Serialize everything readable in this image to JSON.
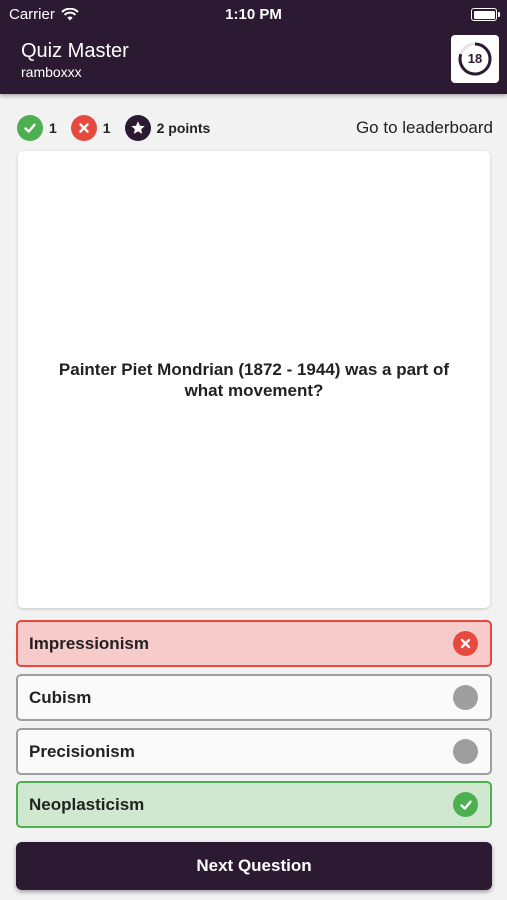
{
  "status_bar": {
    "carrier": "Carrier",
    "time": "1:10 PM"
  },
  "app_bar": {
    "title": "Quiz Master",
    "subtitle": "ramboxxx",
    "timer_value": "18"
  },
  "score": {
    "correct_count": "1",
    "wrong_count": "1",
    "points": "2 points",
    "leaderboard_link": "Go to leaderboard"
  },
  "question": {
    "text": "Painter Piet Mondrian (1872 - 1944) was a part of what movement?"
  },
  "answers": [
    {
      "label": "Impressionism",
      "state": "wrong",
      "icon": "x-circle-icon"
    },
    {
      "label": "Cubism",
      "state": "neutral",
      "icon": "gray-circle-icon"
    },
    {
      "label": "Precisionism",
      "state": "neutral",
      "icon": "gray-circle-icon"
    },
    {
      "label": "Neoplasticism",
      "state": "correct",
      "icon": "check-circle-icon"
    }
  ],
  "next_button": {
    "label": "Next Question"
  },
  "colors": {
    "primary": "#2c1a33",
    "correct": "#4caf50",
    "wrong": "#e64a3e",
    "wrong_bg": "#f8cbcb",
    "correct_bg": "#cfe8cf",
    "neutral_icon": "#9e9e9e"
  }
}
